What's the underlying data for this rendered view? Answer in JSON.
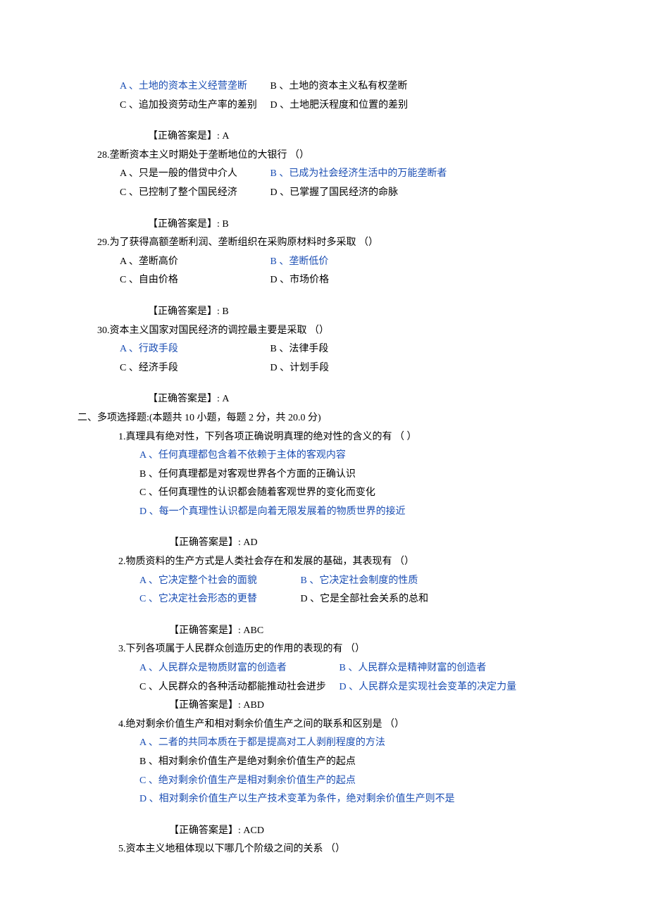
{
  "q27": {
    "optA": "A 、土地的资本主义经营垄断",
    "optB": "B 、土地的资本主义私有权垄断",
    "optC": "C 、追加投资劳动生产率的差别",
    "optD": "D 、土地肥沃程度和位置的差别",
    "answer": "【正确答案是】: A"
  },
  "q28": {
    "stem": "28.垄断资本主义时期处于垄断地位的大银行 （）",
    "optA": "A 、只是一般的借贷中介人",
    "optB": "B 、已成为社会经济生活中的万能垄断者",
    "optC": "C 、已控制了整个国民经济",
    "optD": "D 、已掌握了国民经济的命脉",
    "answer": "【正确答案是】: B"
  },
  "q29": {
    "stem": "29.为了获得高额垄断利润、垄断组织在采购原材料时多采取 （）",
    "optA": "A 、垄断高价",
    "optB": "B 、垄断低价",
    "optC": "C 、自由价格",
    "optD": "D 、市场价格",
    "answer": "【正确答案是】: B"
  },
  "q30": {
    "stem": "30.资本主义国家对国民经济的调控最主要是采取 （）",
    "optA": "A 、行政手段",
    "optB": "B 、法律手段",
    "optC": "C 、经济手段",
    "optD": "D 、计划手段",
    "answer": "【正确答案是】: A"
  },
  "section2": {
    "title": "二、多项选择题:(本题共 10 小题，每题 2 分，共 20.0 分)"
  },
  "m1": {
    "stem": "1.真理具有绝对性，下列各项正确说明真理的绝对性的含义的有 （ ）",
    "optA": "A 、任何真理都包含着不依赖于主体的客观内容",
    "optB": "B 、任何真理都是对客观世界各个方面的正确认识",
    "optC": "C 、任何真理性的认识都会随着客观世界的变化而变化",
    "optD": "D 、每一个真理性认识都是向着无限发展着的物质世界的接近",
    "answer": "【正确答案是】: AD"
  },
  "m2": {
    "stem": "2.物质资料的生产方式是人类社会存在和发展的基础，其表现有 （）",
    "optA": "A 、它决定整个社会的面貌",
    "optB": "B 、它决定社会制度的性质",
    "optC": "C 、它决定社会形态的更替",
    "optD": "D 、它是全部社会关系的总和",
    "answer": "【正确答案是】: ABC"
  },
  "m3": {
    "stem": "3.下列各项属于人民群众创造历史的作用的表现的有 （）",
    "optA": "A 、人民群众是物质财富的创造者",
    "optB": "B 、人民群众是精神财富的创造者",
    "optC": "C 、人民群众的各种活动都能推动社会进步",
    "optD": "D 、人民群众是实现社会变革的决定力量",
    "answer": "【正确答案是】: ABD"
  },
  "m4": {
    "stem": "4.绝对剩余价值生产和相对剩余价值生产之间的联系和区别是 （）",
    "optA": "A 、二者的共同本质在于都是提高对工人剥削程度的方法",
    "optB": "B 、相对剩余价值生产是绝对剩余价值生产的起点",
    "optC": "C 、绝对剩余价值生产是相对剩余价值生产的起点",
    "optD": "D 、相对剩余价值生产以生产技术变革为条件，绝对剩余价值生产则不是",
    "answer": "【正确答案是】: ACD"
  },
  "m5": {
    "stem": "5.资本主义地租体现以下哪几个阶级之间的关系 （）"
  }
}
